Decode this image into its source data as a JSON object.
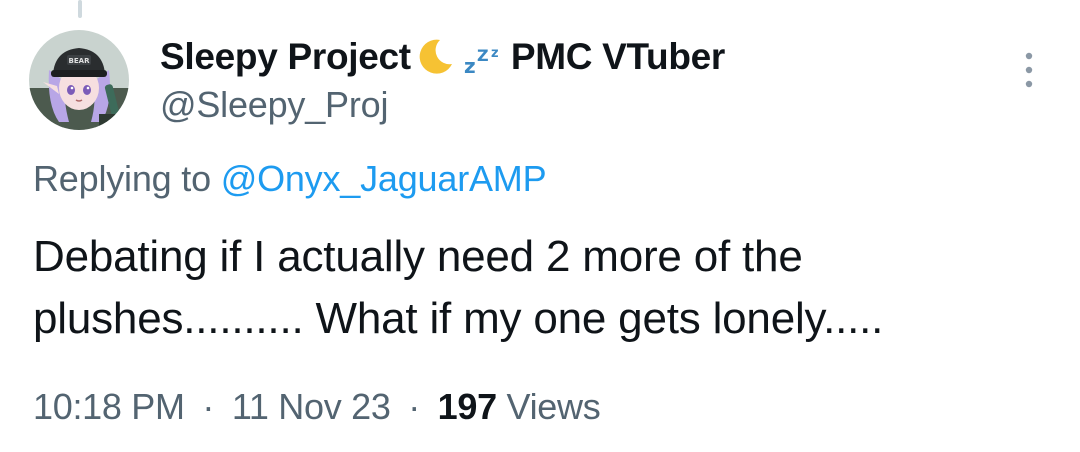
{
  "tweet": {
    "author": {
      "display_name": "Sleepy Project",
      "name_suffix": "PMC VTuber",
      "name_emojis": [
        "crescent-moon-icon",
        "zzz-icon"
      ],
      "handle": "@Sleepy_Proj",
      "avatar_cap_text": "BEAR"
    },
    "reply": {
      "prefix": "Replying to",
      "mention": "@Onyx_JaguarAMP"
    },
    "text_lines": [
      "Debating if I actually need 2 more of the",
      "plushes.......... What if my one gets lonely....."
    ],
    "meta": {
      "time": "10:18 PM",
      "separator": "·",
      "date": "11 Nov 23",
      "views_count": "197",
      "views_label": "Views"
    }
  },
  "colors": {
    "primary_text": "#0f1419",
    "secondary_text": "#536471",
    "link": "#1d9bf0",
    "thread_line": "#cfd9de"
  }
}
